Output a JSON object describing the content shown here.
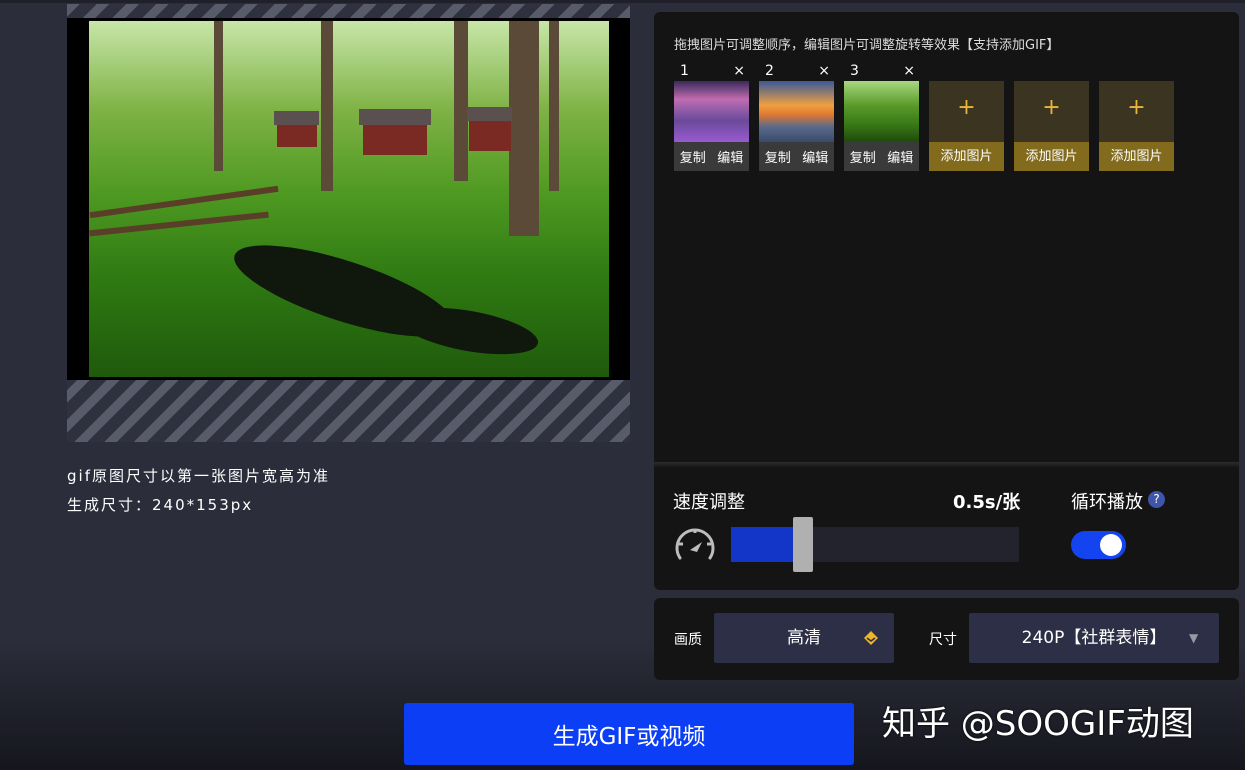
{
  "preview": {
    "info_size_rule": "gif原图尺寸以第一张图片宽高为准",
    "info_output_size": "生成尺寸：240*153px"
  },
  "panel": {
    "hint": "拖拽图片可调整顺序，编辑图片可调整旋转等效果【支持添加GIF】",
    "thumbnails": [
      {
        "index": "1",
        "close": "×",
        "copy": "复制",
        "edit": "编辑"
      },
      {
        "index": "2",
        "close": "×",
        "copy": "复制",
        "edit": "编辑"
      },
      {
        "index": "3",
        "close": "×",
        "copy": "复制",
        "edit": "编辑"
      }
    ],
    "add_tiles": [
      {
        "plus": "+",
        "label": "添加图片"
      },
      {
        "plus": "+",
        "label": "添加图片"
      },
      {
        "plus": "+",
        "label": "添加图片"
      }
    ]
  },
  "speed": {
    "label": "速度调整",
    "value_text": "0.5s/张",
    "slider_fraction": 0.25
  },
  "loop": {
    "label": "循环播放",
    "help": "?",
    "enabled": true
  },
  "settings": {
    "quality_label": "画质",
    "quality_value": "高清",
    "size_label": "尺寸",
    "size_value": "240P【社群表情】",
    "dropdown_arrow": "▼"
  },
  "actions": {
    "generate_label": "生成GIF或视频"
  },
  "watermark": "知乎 @SOOGIF动图",
  "colors": {
    "accent_blue": "#0c3ff5",
    "add_gold": "#826b1d",
    "panel_bg": "#141414"
  }
}
